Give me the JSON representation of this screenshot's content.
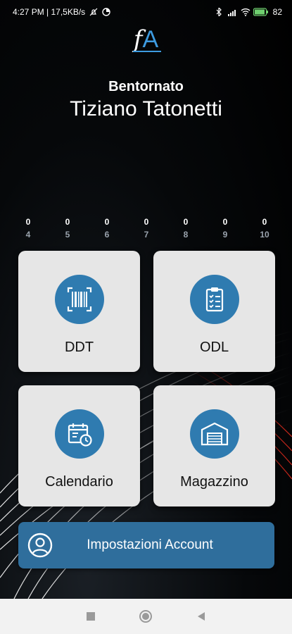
{
  "status_bar": {
    "time_info": "4:27 PM | 17,5KB/s",
    "battery": "82"
  },
  "logo": {
    "f": "f",
    "a": "A"
  },
  "welcome": "Bentornato",
  "user_name": "Tiziano Tatonetti",
  "counters": [
    {
      "value": "0",
      "label": "4"
    },
    {
      "value": "0",
      "label": "5"
    },
    {
      "value": "0",
      "label": "6"
    },
    {
      "value": "0",
      "label": "7"
    },
    {
      "value": "0",
      "label": "8"
    },
    {
      "value": "0",
      "label": "9"
    },
    {
      "value": "0",
      "label": "10"
    }
  ],
  "tiles": {
    "ddt": {
      "label": "DDT",
      "icon": "barcode-scan-icon"
    },
    "odl": {
      "label": "ODL",
      "icon": "clipboard-checklist-icon"
    },
    "calendario": {
      "label": "Calendario",
      "icon": "calendar-clock-icon"
    },
    "magazzino": {
      "label": "Magazzino",
      "icon": "warehouse-icon"
    }
  },
  "account_button": {
    "label": "Impostazioni Account",
    "icon": "user-circle-icon"
  },
  "colors": {
    "accent": "#2f7bb0",
    "account_button": "#2f6e9c",
    "tile_bg": "#e6e6e6",
    "logo_accent": "#3d9be0"
  }
}
